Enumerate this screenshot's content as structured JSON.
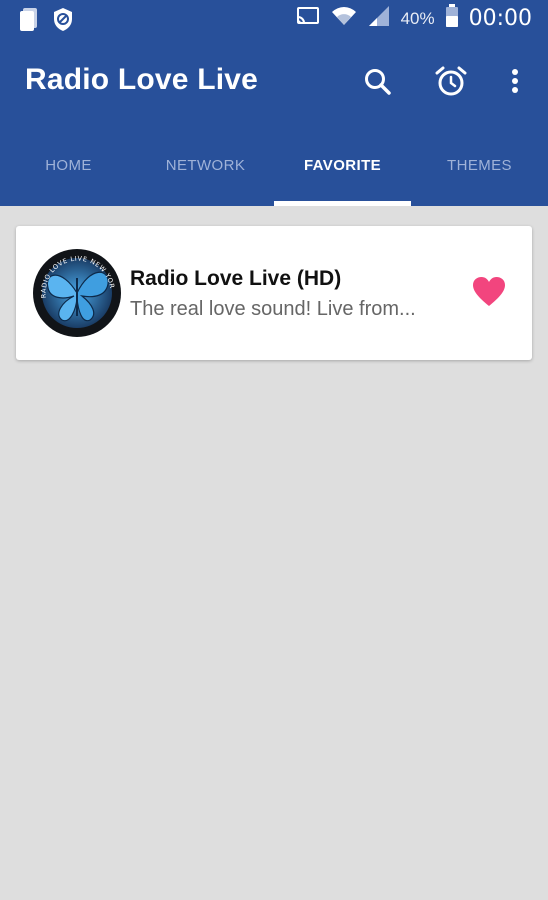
{
  "status_bar": {
    "battery_percent": "40%",
    "time": "00:00",
    "icons": [
      "notes-icon",
      "shield-icon",
      "cast-icon",
      "wifi-icon",
      "signal-icon",
      "battery-icon"
    ]
  },
  "toolbar": {
    "title": "Radio Love Live",
    "icons": [
      "search-icon",
      "alarm-icon",
      "more-vert-icon"
    ]
  },
  "tabs": [
    {
      "label": "HOME",
      "active": false
    },
    {
      "label": "NETWORK",
      "active": false
    },
    {
      "label": "FAVORITE",
      "active": true
    },
    {
      "label": "THEMES",
      "active": false
    }
  ],
  "favorites": [
    {
      "title": "Radio Love Live (HD)",
      "description": "The real love sound! Live from...",
      "logo_text": "RADIO LOVE LIVE NEW YORK",
      "favorited": true
    }
  ],
  "colors": {
    "primary": "#28509a",
    "background": "#dedede",
    "heart": "#f2457e",
    "tab_inactive": "#9fb2d8"
  }
}
